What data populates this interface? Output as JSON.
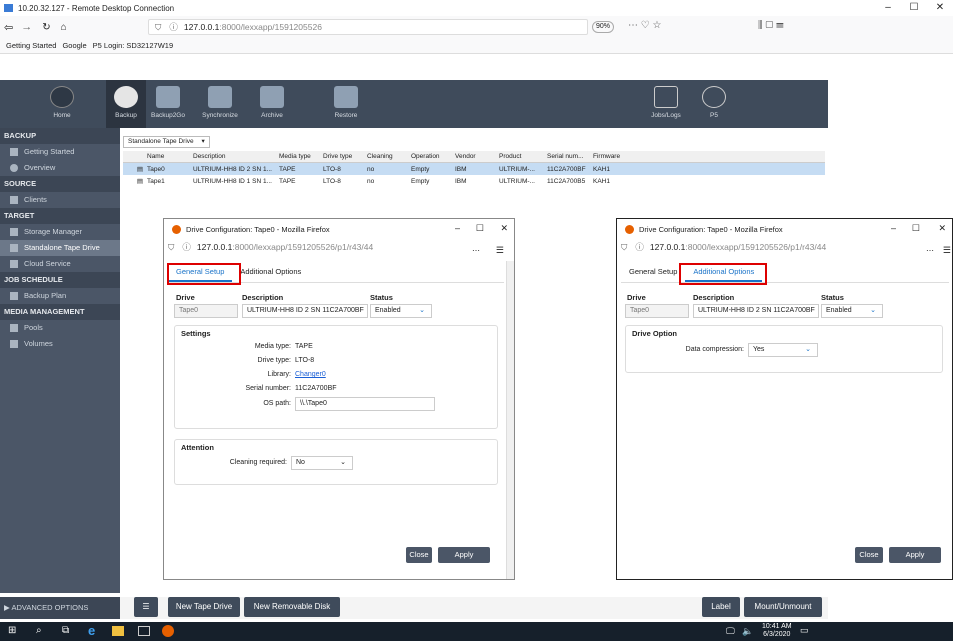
{
  "rdp": {
    "title": "10.20.32.127 - Remote Desktop Connection"
  },
  "browser": {
    "url_host": "127.0.0.1",
    "url_path": ":8000/lexxapp/1591205526",
    "zoom": "90%",
    "bookmarks": [
      "Getting Started",
      "Google",
      "P5 Login: SD32127W19"
    ]
  },
  "toolbar": {
    "items": [
      {
        "label": "Home",
        "icon": "home-icon"
      },
      {
        "label": "Backup",
        "icon": "backup-icon"
      },
      {
        "label": "Backup2Go",
        "icon": "laptop-icon"
      },
      {
        "label": "Synchronize",
        "icon": "sync-icon"
      },
      {
        "label": "Archive",
        "icon": "archive-icon"
      },
      {
        "label": "Restore",
        "icon": "restore-icon"
      }
    ],
    "right": [
      "Jobs/Logs",
      "P5"
    ]
  },
  "sidebar": {
    "backup_h": "BACKUP",
    "getting_started": "Getting Started",
    "overview": "Overview",
    "source_h": "SOURCE",
    "clients": "Clients",
    "target_h": "TARGET",
    "storage_manager": "Storage Manager",
    "standalone_tape": "Standalone Tape Drive",
    "cloud_service": "Cloud Service",
    "job_h": "JOB SCHEDULE",
    "backup_plan": "Backup Plan",
    "media_h": "MEDIA MANAGEMENT",
    "pools": "Pools",
    "volumes": "Volumes",
    "advanced": "ADVANCED OPTIONS"
  },
  "content": {
    "tab": "Standalone Tape Drive",
    "columns": [
      "Name",
      "Description",
      "Media type",
      "Drive type",
      "Cleaning",
      "Operation",
      "Vendor",
      "Product",
      "Serial num...",
      "Firmware"
    ],
    "rows": [
      [
        "Tape0",
        "ULTRIUM-HH8 ID 2 SN 1...",
        "TAPE",
        "LTO-8",
        "no",
        "Empty",
        "IBM",
        "ULTRIUM-...",
        "11C2A700BF",
        "KAH1"
      ],
      [
        "Tape1",
        "ULTRIUM-HH8 ID 1 SN 1...",
        "TAPE",
        "LTO-8",
        "no",
        "Empty",
        "IBM",
        "ULTRIUM-...",
        "11C2A700B5",
        "KAH1"
      ]
    ]
  },
  "bottombar": {
    "new_tape": "New Tape Drive",
    "new_removable": "New Removable Disk",
    "label": "Label",
    "mount": "Mount/Unmount"
  },
  "taskbar": {
    "time": "10:41 AM",
    "date": "6/3/2020"
  },
  "dialog1": {
    "title": "Drive Configuration: Tape0 - Mozilla Firefox",
    "url_host": "127.0.0.1",
    "url_path": ":8000/lexxapp/1591205526/p1/r43/44",
    "tab_general": "General Setup",
    "tab_additional": "Additional Options",
    "h_drive": "Drive",
    "h_desc": "Description",
    "h_status": "Status",
    "drive": "Tape0",
    "desc": "ULTRIUM-HH8 ID 2 SN 11C2A700BF",
    "status": "Enabled",
    "settings_h": "Settings",
    "media_type_k": "Media type:",
    "media_type_v": "TAPE",
    "drive_type_k": "Drive type:",
    "drive_type_v": "LTO-8",
    "library_k": "Library:",
    "library_v": "Changer0",
    "serial_k": "Serial number:",
    "serial_v": "11C2A700BF",
    "ospath_k": "OS path:",
    "ospath_v": "\\\\.\\Tape0",
    "attention_h": "Attention",
    "cleaning_k": "Cleaning required:",
    "cleaning_v": "No",
    "close": "Close",
    "apply": "Apply"
  },
  "dialog2": {
    "title": "Drive Configuration: Tape0 - Mozilla Firefox",
    "url_host": "127.0.0.1",
    "url_path": ":8000/lexxapp/1591205526/p1/r43/44",
    "tab_general": "General Setup",
    "tab_additional": "Additional Options",
    "h_drive": "Drive",
    "h_desc": "Description",
    "h_status": "Status",
    "drive": "Tape0",
    "desc": "ULTRIUM-HH8 ID 2 SN 11C2A700BF",
    "status": "Enabled",
    "option_h": "Drive Option",
    "compression_k": "Data compression:",
    "compression_v": "Yes",
    "close": "Close",
    "apply": "Apply"
  }
}
